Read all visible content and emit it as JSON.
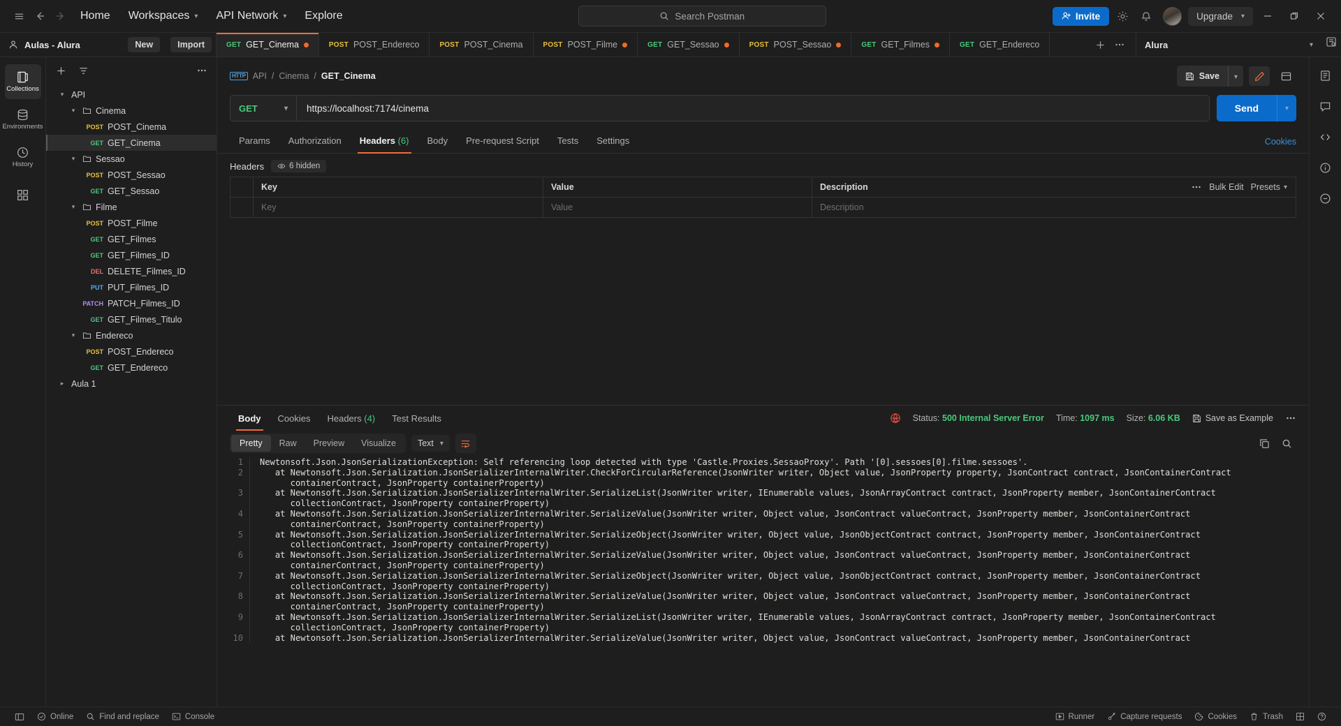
{
  "topbar": {
    "hamburger_icon": "hamburger-icon",
    "back_icon": "arrow-left-icon",
    "forward_icon": "arrow-right-icon",
    "home_label": "Home",
    "workspaces_label": "Workspaces",
    "api_network_label": "API Network",
    "explore_label": "Explore",
    "search_placeholder": "Search Postman",
    "invite_label": "Invite",
    "settings_icon": "gear-icon",
    "notifications_icon": "bell-icon",
    "avatar_icon": "avatar",
    "upgrade_label": "Upgrade",
    "minimize_label": "—",
    "maximize_label": "❐",
    "close_label": "✕"
  },
  "workspace": {
    "name": "Aulas - Alura",
    "new_label": "New",
    "import_label": "Import"
  },
  "tabs": [
    {
      "verb": "GET",
      "verb_class": "v-get",
      "label": "GET_Cinema",
      "dirty": true,
      "active": true
    },
    {
      "verb": "POST",
      "verb_class": "v-post",
      "label": "POST_Endereco",
      "dirty": false,
      "active": false
    },
    {
      "verb": "POST",
      "verb_class": "v-post",
      "label": "POST_Cinema",
      "dirty": false,
      "active": false
    },
    {
      "verb": "POST",
      "verb_class": "v-post",
      "label": "POST_Filme",
      "dirty": true,
      "active": false
    },
    {
      "verb": "GET",
      "verb_class": "v-get",
      "label": "GET_Sessao",
      "dirty": true,
      "active": false
    },
    {
      "verb": "POST",
      "verb_class": "v-post",
      "label": "POST_Sessao",
      "dirty": true,
      "active": false
    },
    {
      "verb": "GET",
      "verb_class": "v-get",
      "label": "GET_Filmes",
      "dirty": true,
      "active": false
    },
    {
      "verb": "GET",
      "verb_class": "v-get",
      "label": "GET_Endereco",
      "dirty": false,
      "active": false
    }
  ],
  "tab_actions": {
    "new_tab_icon": "plus-icon",
    "more_icon": "ellipsis-icon"
  },
  "environment": {
    "name": "Alura",
    "caret": "⌄",
    "eye_icon": "environment-quick-look-icon"
  },
  "rail": [
    {
      "icon": "collections-icon",
      "label": "Collections",
      "active": true
    },
    {
      "icon": "environments-icon",
      "label": "Environments",
      "active": false
    },
    {
      "icon": "history-icon",
      "label": "History",
      "active": false
    },
    {
      "icon": "apps-icon",
      "label": "",
      "active": false
    }
  ],
  "sidebar_tools": {
    "add_icon": "plus-icon",
    "filter_icon": "filter-icon",
    "more_icon": "ellipsis-icon"
  },
  "tree": [
    {
      "type": "collection",
      "label": "API",
      "indent": 0,
      "expanded": true
    },
    {
      "type": "folder",
      "label": "Cinema",
      "indent": 1,
      "expanded": true
    },
    {
      "type": "request",
      "verb": "POST",
      "verb_class": "v-post",
      "label": "POST_Cinema",
      "indent": 2,
      "selected": false
    },
    {
      "type": "request",
      "verb": "GET",
      "verb_class": "v-get",
      "label": "GET_Cinema",
      "indent": 2,
      "selected": true
    },
    {
      "type": "folder",
      "label": "Sessao",
      "indent": 1,
      "expanded": true
    },
    {
      "type": "request",
      "verb": "POST",
      "verb_class": "v-post",
      "label": "POST_Sessao",
      "indent": 2,
      "selected": false
    },
    {
      "type": "request",
      "verb": "GET",
      "verb_class": "v-get",
      "label": "GET_Sessao",
      "indent": 2,
      "selected": false
    },
    {
      "type": "folder",
      "label": "Filme",
      "indent": 1,
      "expanded": true
    },
    {
      "type": "request",
      "verb": "POST",
      "verb_class": "v-post",
      "label": "POST_Filme",
      "indent": 2,
      "selected": false
    },
    {
      "type": "request",
      "verb": "GET",
      "verb_class": "v-get",
      "label": "GET_Filmes",
      "indent": 2,
      "selected": false
    },
    {
      "type": "request",
      "verb": "GET",
      "verb_class": "v-get",
      "label": "GET_Filmes_ID",
      "indent": 2,
      "selected": false
    },
    {
      "type": "request",
      "verb": "DEL",
      "verb_class": "v-del",
      "label": "DELETE_Filmes_ID",
      "indent": 2,
      "selected": false
    },
    {
      "type": "request",
      "verb": "PUT",
      "verb_class": "v-put",
      "label": "PUT_Filmes_ID",
      "indent": 2,
      "selected": false
    },
    {
      "type": "request",
      "verb": "PATCH",
      "verb_class": "v-patch",
      "label": "PATCH_Filmes_ID",
      "indent": 2,
      "selected": false
    },
    {
      "type": "request",
      "verb": "GET",
      "verb_class": "v-get",
      "label": "GET_Filmes_Titulo",
      "indent": 2,
      "selected": false
    },
    {
      "type": "folder",
      "label": "Endereco",
      "indent": 1,
      "expanded": true
    },
    {
      "type": "request",
      "verb": "POST",
      "verb_class": "v-post",
      "label": "POST_Endereco",
      "indent": 2,
      "selected": false
    },
    {
      "type": "request",
      "verb": "GET",
      "verb_class": "v-get",
      "label": "GET_Endereco",
      "indent": 2,
      "selected": false
    },
    {
      "type": "collection",
      "label": "Aula 1",
      "indent": 0,
      "expanded": false
    }
  ],
  "request": {
    "protocol_badge": "HTTP",
    "breadcrumb": [
      "API",
      "Cinema",
      "GET_Cinema"
    ],
    "save_label": "Save",
    "save_icon": "save-icon",
    "edit_icon": "pencil-icon",
    "panel_icon": "panel-layout-icon",
    "method": "GET",
    "url": "https://localhost:7174/cinema",
    "send_label": "Send",
    "tabs": [
      {
        "label": "Params",
        "count": "",
        "active": false
      },
      {
        "label": "Authorization",
        "count": "",
        "active": false
      },
      {
        "label": "Headers",
        "count": "(6)",
        "active": true
      },
      {
        "label": "Body",
        "count": "",
        "active": false
      },
      {
        "label": "Pre-request Script",
        "count": "",
        "active": false
      },
      {
        "label": "Tests",
        "count": "",
        "active": false
      },
      {
        "label": "Settings",
        "count": "",
        "active": false
      }
    ],
    "cookies_link": "Cookies",
    "headers_label": "Headers",
    "hidden_pill": "6 hidden",
    "eye_icon": "eye-icon",
    "table": {
      "columns": [
        "Key",
        "Value",
        "Description"
      ],
      "rows": [
        {
          "key": "Key",
          "value": "Value",
          "description": "Description"
        }
      ],
      "more_icon": "ellipsis-icon",
      "bulk_edit_label": "Bulk Edit",
      "presets_label": "Presets"
    }
  },
  "response": {
    "tabs": [
      {
        "label": "Body",
        "count": "",
        "active": true
      },
      {
        "label": "Cookies",
        "count": "",
        "active": false
      },
      {
        "label": "Headers",
        "count": "(4)",
        "active": false
      },
      {
        "label": "Test Results",
        "count": "",
        "active": false
      }
    ],
    "status_warn_icon": "error-globe-icon",
    "status_label": "Status:",
    "status_value": "500 Internal Server Error",
    "time_label": "Time:",
    "time_value": "1097 ms",
    "size_label": "Size:",
    "size_value": "6.06 KB",
    "save_example_label": "Save as Example",
    "save_example_icon": "floppy-icon",
    "more_icon": "ellipsis-icon",
    "format_tabs": [
      {
        "label": "Pretty",
        "active": true
      },
      {
        "label": "Raw",
        "active": false
      },
      {
        "label": "Preview",
        "active": false
      },
      {
        "label": "Visualize",
        "active": false
      }
    ],
    "language": "Text",
    "wrap_icon": "wrap-lines-icon",
    "copy_icon": "copy-icon",
    "search_icon": "search-icon",
    "body_lines": [
      {
        "n": 1,
        "text": "Newtonsoft.Json.JsonSerializationException: Self referencing loop detected with type 'Castle.Proxies.SessaoProxy'. Path '[0].sessoes[0].filme.sessoes'."
      },
      {
        "n": 2,
        "text": "   at Newtonsoft.Json.Serialization.JsonSerializerInternalWriter.CheckForCircularReference(JsonWriter writer, Object value, JsonProperty property, JsonContract contract, JsonContainerContract\n      containerContract, JsonProperty containerProperty)"
      },
      {
        "n": 3,
        "text": "   at Newtonsoft.Json.Serialization.JsonSerializerInternalWriter.SerializeList(JsonWriter writer, IEnumerable values, JsonArrayContract contract, JsonProperty member, JsonContainerContract\n      collectionContract, JsonProperty containerProperty)"
      },
      {
        "n": 4,
        "text": "   at Newtonsoft.Json.Serialization.JsonSerializerInternalWriter.SerializeValue(JsonWriter writer, Object value, JsonContract valueContract, JsonProperty member, JsonContainerContract\n      containerContract, JsonProperty containerProperty)"
      },
      {
        "n": 5,
        "text": "   at Newtonsoft.Json.Serialization.JsonSerializerInternalWriter.SerializeObject(JsonWriter writer, Object value, JsonObjectContract contract, JsonProperty member, JsonContainerContract\n      collectionContract, JsonProperty containerProperty)"
      },
      {
        "n": 6,
        "text": "   at Newtonsoft.Json.Serialization.JsonSerializerInternalWriter.SerializeValue(JsonWriter writer, Object value, JsonContract valueContract, JsonProperty member, JsonContainerContract\n      containerContract, JsonProperty containerProperty)"
      },
      {
        "n": 7,
        "text": "   at Newtonsoft.Json.Serialization.JsonSerializerInternalWriter.SerializeObject(JsonWriter writer, Object value, JsonObjectContract contract, JsonProperty member, JsonContainerContract\n      collectionContract, JsonProperty containerProperty)"
      },
      {
        "n": 8,
        "text": "   at Newtonsoft.Json.Serialization.JsonSerializerInternalWriter.SerializeValue(JsonWriter writer, Object value, JsonContract valueContract, JsonProperty member, JsonContainerContract\n      containerContract, JsonProperty containerProperty)"
      },
      {
        "n": 9,
        "text": "   at Newtonsoft.Json.Serialization.JsonSerializerInternalWriter.SerializeList(JsonWriter writer, IEnumerable values, JsonArrayContract contract, JsonProperty member, JsonContainerContract\n      collectionContract, JsonProperty containerProperty)"
      },
      {
        "n": 10,
        "text": "   at Newtonsoft.Json.Serialization.JsonSerializerInternalWriter.SerializeValue(JsonWriter writer, Object value, JsonContract valueContract, JsonProperty member, JsonContainerContract"
      }
    ]
  },
  "footer": {
    "left": [
      {
        "icon": "sidebar-toggle-icon",
        "label": ""
      },
      {
        "icon": "online-icon",
        "label": "Online"
      },
      {
        "icon": "search-icon",
        "label": "Find and replace"
      },
      {
        "icon": "console-icon",
        "label": "Console"
      }
    ],
    "right": [
      {
        "icon": "runner-icon",
        "label": "Runner"
      },
      {
        "icon": "capture-icon",
        "label": "Capture requests"
      },
      {
        "icon": "cookie-icon",
        "label": "Cookies"
      },
      {
        "icon": "trash-icon",
        "label": "Trash"
      },
      {
        "icon": "layout-icon",
        "label": ""
      },
      {
        "icon": "help-icon",
        "label": ""
      }
    ]
  },
  "right_rail": [
    {
      "icon": "documentation-icon"
    },
    {
      "icon": "comments-icon"
    },
    {
      "icon": "code-icon"
    },
    {
      "icon": "info-circle-icon"
    },
    {
      "icon": "info-detail-icon"
    }
  ],
  "colors": {
    "accent": "#ef6c38",
    "primary": "#0b6bcb",
    "get": "#49c97c",
    "post": "#e8c13b",
    "delete": "#e8736c",
    "put": "#5aa9f0",
    "patch": "#b18cf0",
    "error": "#e24b3c",
    "bg": "#1e1e1e"
  }
}
